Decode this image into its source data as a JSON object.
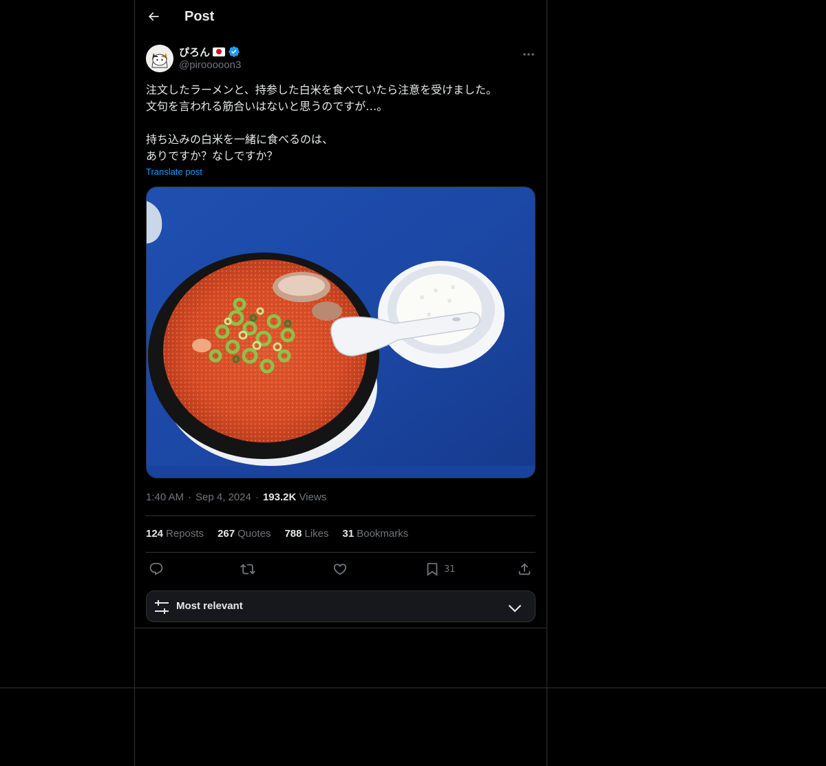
{
  "header": {
    "title": "Post"
  },
  "author": {
    "display_name": "ぴろん",
    "handle": "@pirooooon3",
    "verified": true,
    "flag": "JP"
  },
  "post": {
    "text": "注文したラーメンと、持参した白米を食べていたら注意を受けました。\n文句を言われる筋合いはないと思うのですが…。\n\n持ち込みの白米を一緒に食べるのは、\nありですか？なしですか？",
    "translate_label": "Translate post",
    "media_description": "Bowl of spicy red ramen topped with green onions and chashu on a blue table, next to a small bowl of white rice with a white spoon"
  },
  "meta": {
    "time": "1:40 AM",
    "date": "Sep 4, 2024",
    "views_count": "193.2K",
    "views_label": "Views",
    "separator": "·"
  },
  "stats": {
    "reposts": {
      "count": "124",
      "label": "Reposts"
    },
    "quotes": {
      "count": "267",
      "label": "Quotes"
    },
    "likes": {
      "count": "788",
      "label": "Likes"
    },
    "bookmarks": {
      "count": "31",
      "label": "Bookmarks"
    }
  },
  "actions": {
    "bookmark_count": "31"
  },
  "sort": {
    "label": "Most relevant"
  },
  "colors": {
    "background": "#000000",
    "text": "#e7e9ea",
    "muted": "#71767b",
    "accent": "#1d9bf0",
    "border": "#2f3336"
  }
}
